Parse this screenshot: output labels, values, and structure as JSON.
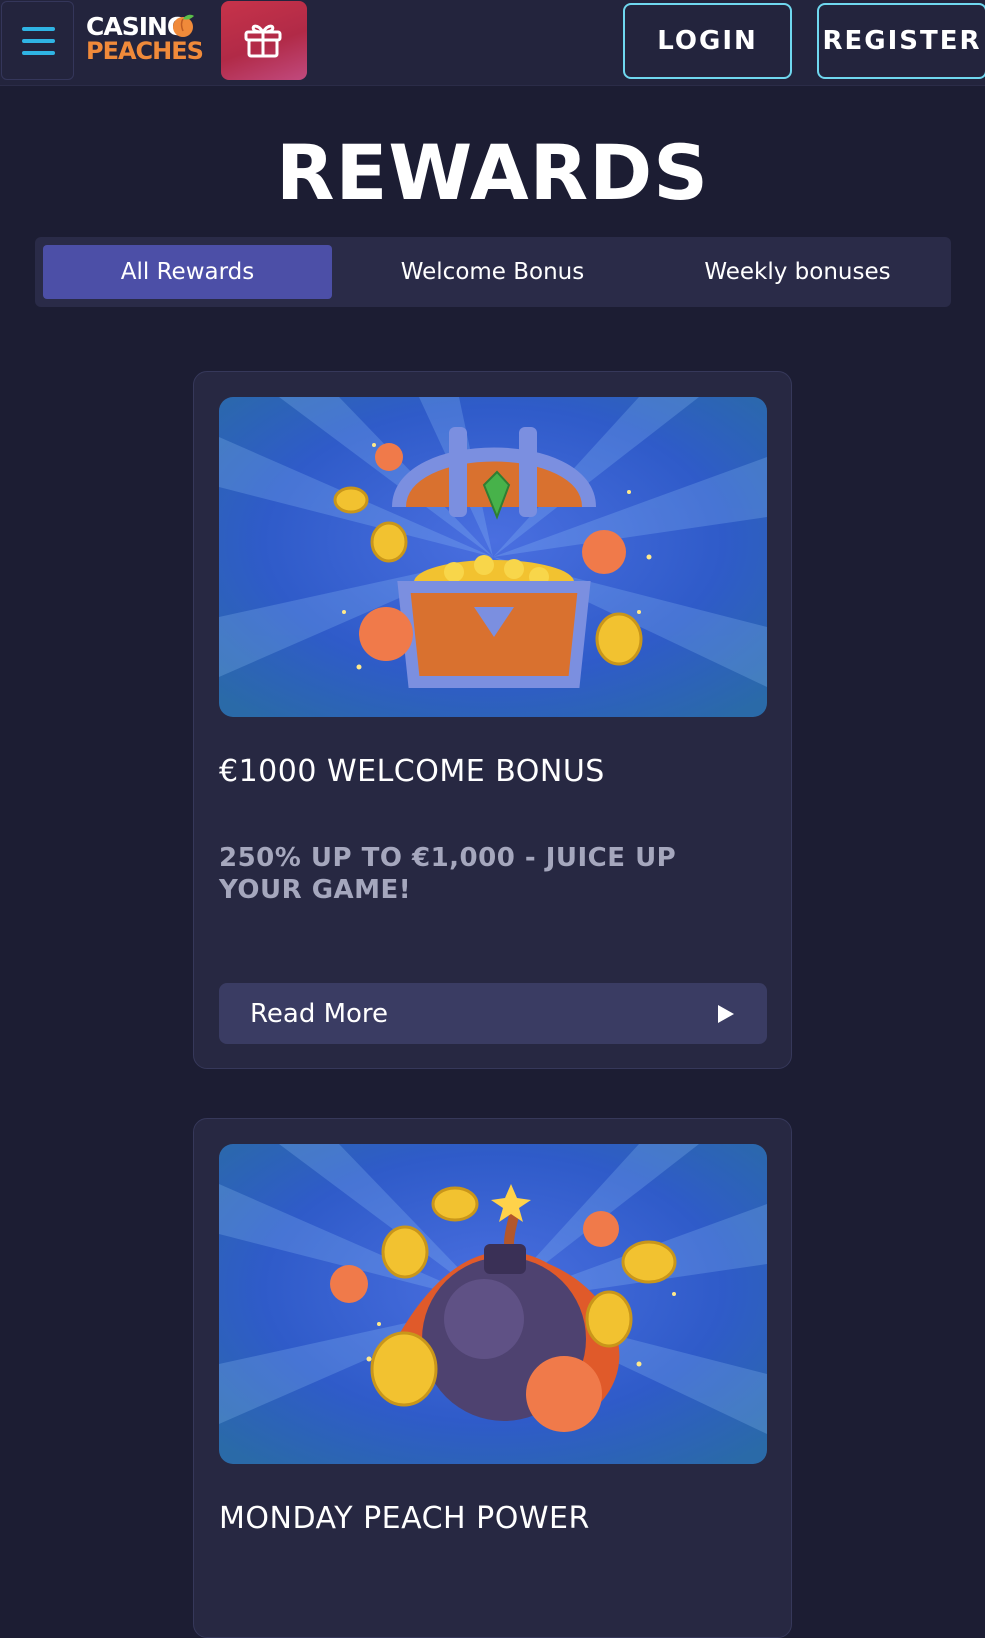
{
  "header": {
    "menu_icon": "hamburger-menu-icon",
    "logo_line1": "CASINO",
    "logo_line2": "PEACHES",
    "gift_icon": "gift-icon",
    "login_label": "LOGIN",
    "register_label": "REGISTER"
  },
  "page_title": "REWARDS",
  "tabs": [
    {
      "label": "All Rewards",
      "active": true
    },
    {
      "label": "Welcome Bonus",
      "active": false
    },
    {
      "label": "Weekly bonuses",
      "active": false
    }
  ],
  "cards": [
    {
      "image": "treasure-chest-illustration",
      "title": "€1000 WELCOME BONUS",
      "description": "250% UP TO €1,000 - JUICE UP YOUR GAME!",
      "button_label": "Read More",
      "button_icon": "play-arrow-icon"
    },
    {
      "image": "bomb-peach-illustration",
      "title": "MONDAY PEACH POWER"
    }
  ],
  "colors": {
    "background": "#1c1d33",
    "header": "#23243d",
    "accent_cyan": "#6fd7ef",
    "tab_active": "#4c4fa7",
    "gift_red": "#c7334a",
    "peach_orange": "#f08a3a"
  }
}
